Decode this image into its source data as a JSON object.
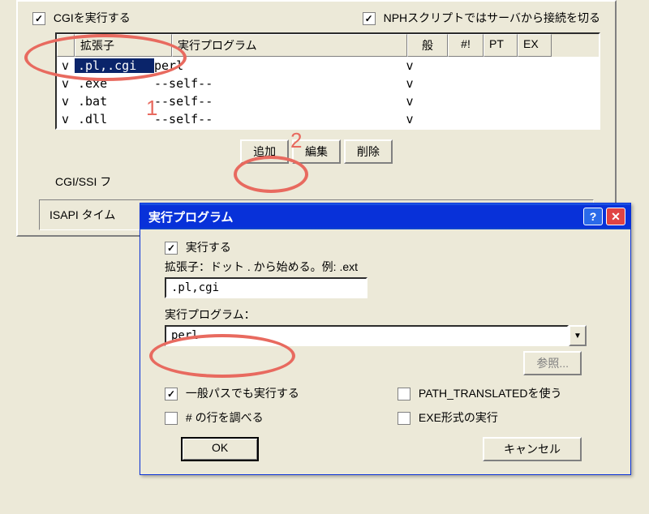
{
  "panel": {
    "chk_cgi": "CGIを実行する",
    "chk_nph": "NPHスクリプトではサーバから接続を切る",
    "headers": {
      "ext": "拡張子",
      "prog": "実行プログラム",
      "gen": "般",
      "hash": "#!",
      "pt": "PT",
      "ex": "EX"
    },
    "rows": [
      {
        "v": "v",
        "ext": ".pl,.cgi",
        "prog": "perl",
        "gen": "v"
      },
      {
        "v": "v",
        "ext": ".exe",
        "prog": "--self--",
        "gen": "v"
      },
      {
        "v": "v",
        "ext": ".bat",
        "prog": "--self--",
        "gen": "v"
      },
      {
        "v": "v",
        "ext": ".dll",
        "prog": "--self--",
        "gen": "v"
      }
    ],
    "btn_add": "追加",
    "btn_edit": "編集",
    "btn_del": "削除",
    "cgi_ssi": "CGI/SSI フ",
    "isapi": "ISAPI タイム"
  },
  "dialog": {
    "title": "実行プログラム",
    "chk_exec": "実行する",
    "ext_label": "拡張子：ドット . から始める。例: .ext",
    "ext_value": ".pl,cgi",
    "prog_label": "実行プログラム：",
    "prog_value": "perl",
    "browse": "参照...",
    "chk_general": "一般パスでも実行する",
    "chk_path": "PATH_TRANSLATEDを使う",
    "chk_hash": "# の行を調べる",
    "chk_exe": "EXE形式の実行",
    "ok": "OK",
    "cancel": "キャンセル"
  },
  "annotations": {
    "one": "1",
    "two": "2"
  }
}
